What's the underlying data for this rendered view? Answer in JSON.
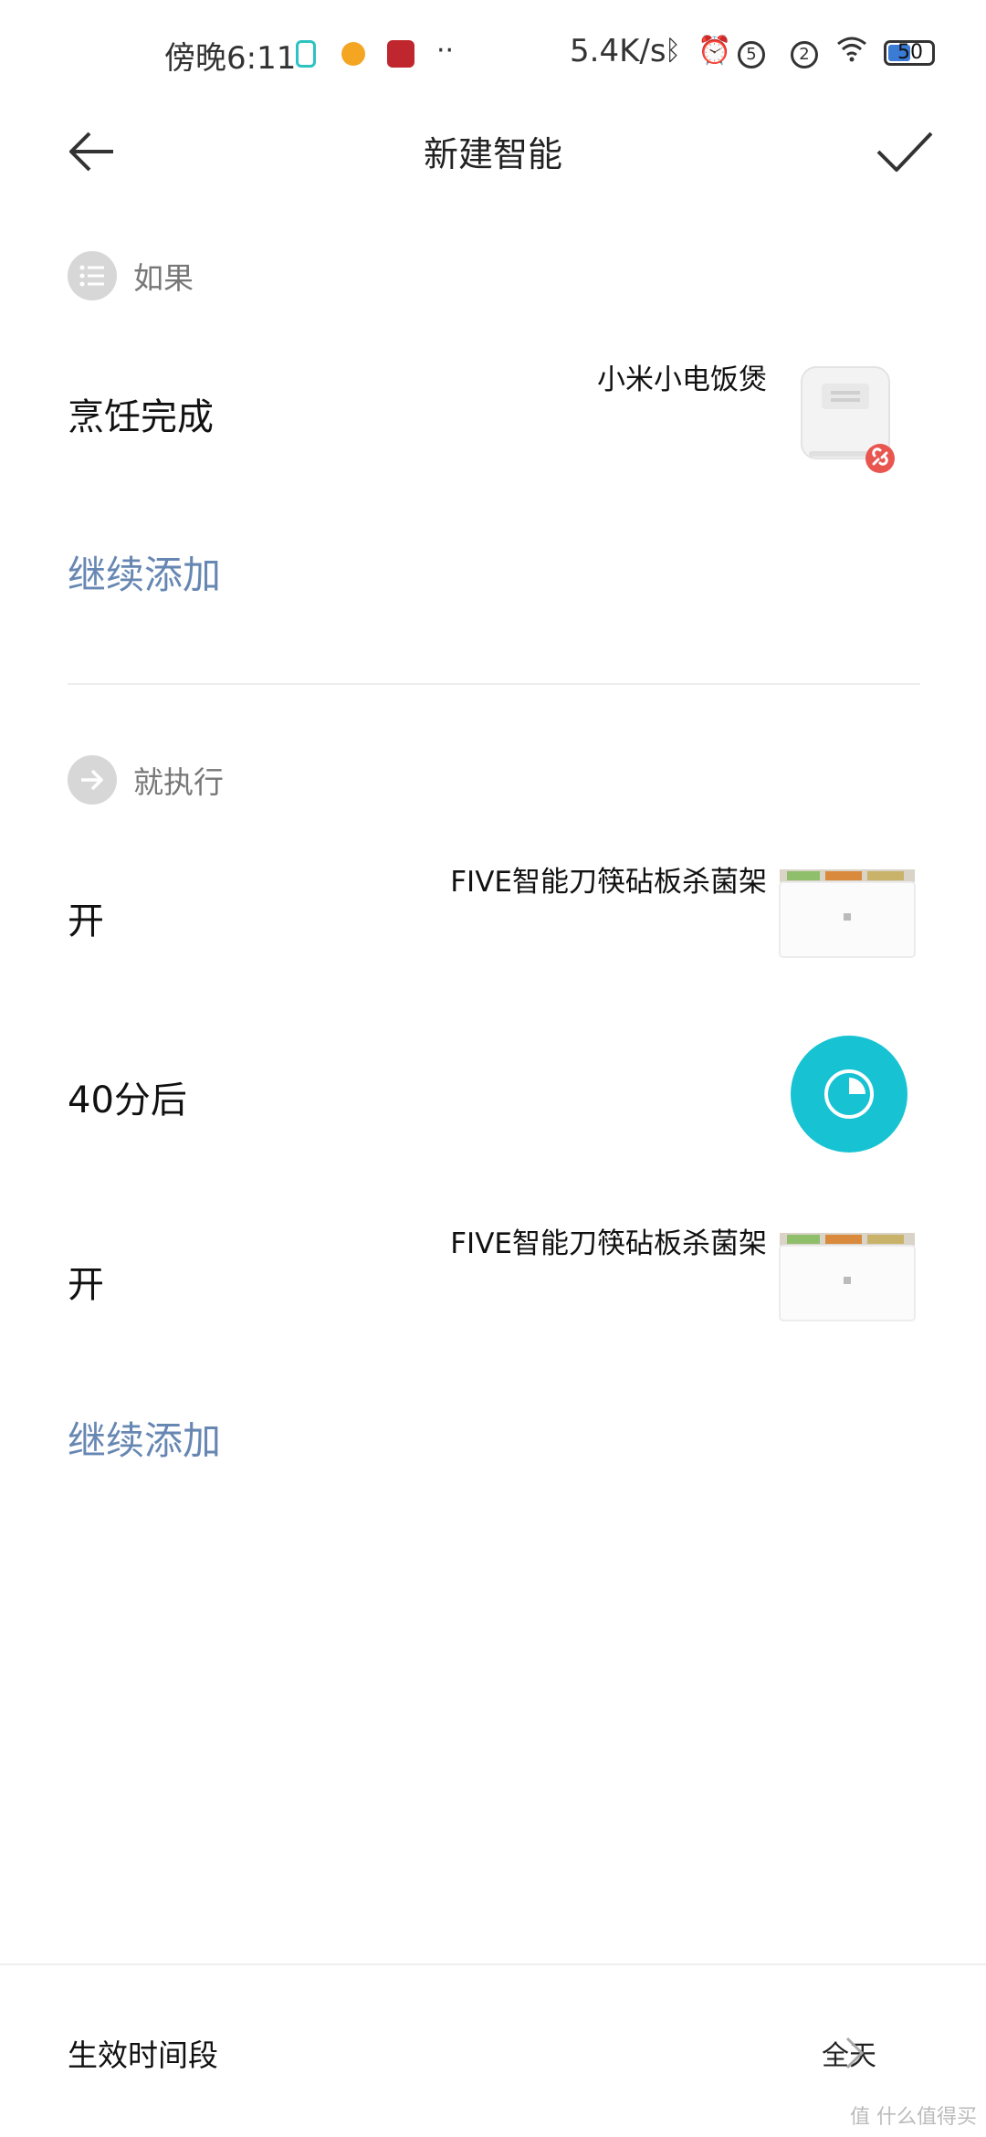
{
  "status_bar": {
    "time": "傍晚6:11",
    "net_speed": "5.4K/s",
    "sim_badges": [
      "5",
      "2"
    ],
    "battery": "50"
  },
  "header": {
    "title": "新建智能"
  },
  "if_section": {
    "label": "如果",
    "trigger": {
      "action": "烹饪完成",
      "device": "小米小电饭煲"
    },
    "add_more": "继续添加"
  },
  "then_section": {
    "label": "就执行",
    "actions": [
      {
        "action": "开",
        "device": "FIVE智能刀筷砧板杀菌架"
      },
      {
        "action": "40分后"
      },
      {
        "action": "开",
        "device": "FIVE智能刀筷砧板杀菌架"
      }
    ],
    "add_more": "继续添加"
  },
  "effective_period": {
    "label": "生效时间段",
    "value": "全天"
  },
  "watermark": "值 什么值得买",
  "colors": {
    "accent_link": "#6787b3",
    "timer": "#17c3d3",
    "badge_red": "#e8564f"
  }
}
